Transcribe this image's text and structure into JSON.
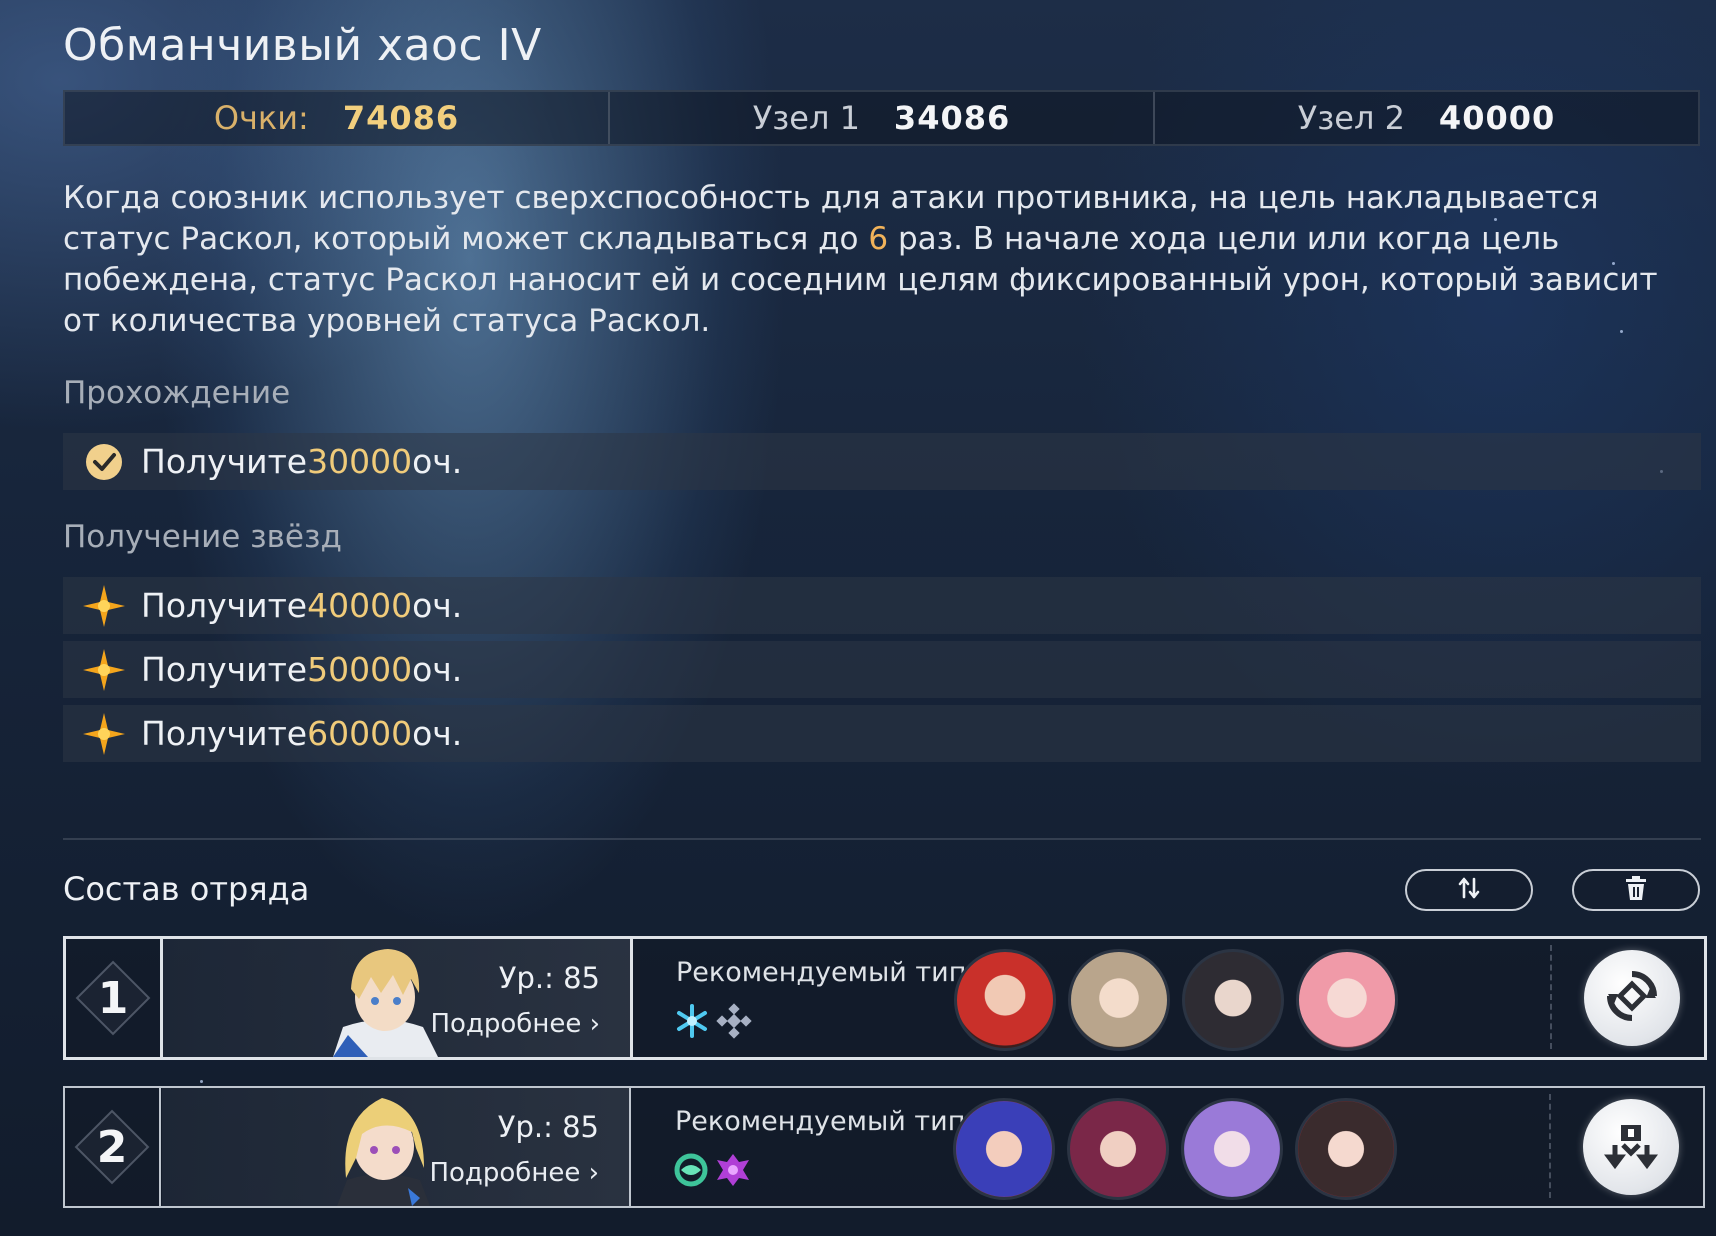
{
  "title": "Обманчивый хаос IV",
  "scores": {
    "total_label": "Очки:",
    "total_value": "74086",
    "node1_label": "Узел 1",
    "node1_value": "34086",
    "node2_label": "Узел 2",
    "node2_value": "40000"
  },
  "description": {
    "part1": "Когда союзник использует сверхспособность для атаки противника, на цель накладывается статус Раскол, который может складываться до ",
    "highlight": "6",
    "part2": " раз. В начале хода цели или когда цель побеждена, статус Раскол наносит ей и соседним целям фиксированный урон, который зависит от количества уровней статуса Раскол."
  },
  "completion": {
    "label": "Прохождение",
    "task": {
      "prefix": "Получите ",
      "value": "30000",
      "suffix": " оч.",
      "icon": "checkmark-icon"
    }
  },
  "stars": {
    "label": "Получение звёзд",
    "tasks": [
      {
        "prefix": "Получите ",
        "value": "40000",
        "suffix": " оч.",
        "icon": "star-icon"
      },
      {
        "prefix": "Получите ",
        "value": "50000",
        "suffix": " оч.",
        "icon": "star-icon"
      },
      {
        "prefix": "Получите ",
        "value": "60000",
        "suffix": " оч.",
        "icon": "star-icon"
      }
    ]
  },
  "team": {
    "label": "Состав отряда",
    "swap_icon": "swap-icon",
    "delete_icon": "trash-icon",
    "rows": [
      {
        "number": "1",
        "level": "Ур.: 85",
        "details": "Подробнее",
        "recommended_label": "Рекомендуемый тип",
        "elements": [
          "ice-element-icon",
          "quantum-element-icon"
        ],
        "action_icon": "swap-team-icon"
      },
      {
        "number": "2",
        "level": "Ур.: 85",
        "details": "Подробнее",
        "recommended_label": "Рекомендуемый тип",
        "elements": [
          "wind-element-icon",
          "imaginary-element-icon"
        ],
        "action_icon": "swap-team-icon"
      }
    ]
  },
  "colors": {
    "accent_gold": "#f2cf7e",
    "highlight_orange": "#f2b35a"
  }
}
